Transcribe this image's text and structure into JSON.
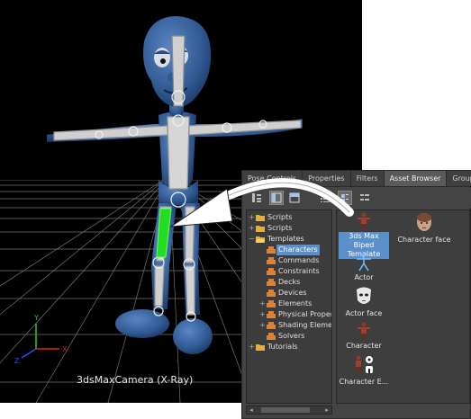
{
  "viewport": {
    "label": "3dsMaxCamera (X-Ray)",
    "axes": {
      "x": "X",
      "y": "Y",
      "z": "Z"
    }
  },
  "panel": {
    "tabs": [
      {
        "label": "Pose Controls",
        "active": false
      },
      {
        "label": "Properties",
        "active": false
      },
      {
        "label": "Filters",
        "active": false
      },
      {
        "label": "Asset Browser",
        "active": true
      },
      {
        "label": "Groups",
        "active": false
      }
    ],
    "tree": [
      {
        "label": "Scripts",
        "depth": 0,
        "expander": "+",
        "icon": "folder-icon"
      },
      {
        "label": "Scripts",
        "depth": 0,
        "expander": "+",
        "icon": "folder-icon"
      },
      {
        "label": "Templates",
        "depth": 0,
        "expander": "−",
        "icon": "folder-icon"
      },
      {
        "label": "Characters",
        "depth": 1,
        "expander": "",
        "icon": "template-icon",
        "selected": true
      },
      {
        "label": "Commands",
        "depth": 1,
        "expander": "",
        "icon": "template-icon"
      },
      {
        "label": "Constraints",
        "depth": 1,
        "expander": "",
        "icon": "template-icon"
      },
      {
        "label": "Decks",
        "depth": 1,
        "expander": "",
        "icon": "template-icon"
      },
      {
        "label": "Devices",
        "depth": 1,
        "expander": "",
        "icon": "template-icon"
      },
      {
        "label": "Elements",
        "depth": 1,
        "expander": "+",
        "icon": "template-icon"
      },
      {
        "label": "Physical Proper",
        "depth": 1,
        "expander": "+",
        "icon": "template-icon"
      },
      {
        "label": "Shading Eleme",
        "depth": 1,
        "expander": "+",
        "icon": "template-icon"
      },
      {
        "label": "Solvers",
        "depth": 1,
        "expander": "",
        "icon": "template-icon"
      },
      {
        "label": "Tutorials",
        "depth": 0,
        "expander": "+",
        "icon": "folder-icon"
      }
    ],
    "assets": [
      {
        "label": "3ds Max Biped Template",
        "line1": "3ds Max Biped",
        "line2": "Template",
        "icon": "biped-template-icon",
        "selected": true
      },
      {
        "label": "Character face",
        "line1": "Character face",
        "line2": "",
        "icon": "character-face-icon"
      },
      {
        "label": "Actor",
        "line1": "Actor",
        "line2": "",
        "icon": "actor-icon"
      },
      {
        "label": "Actor face",
        "line1": "Actor face",
        "line2": "",
        "icon": "actor-face-icon"
      },
      {
        "label": "Character",
        "line1": "Character",
        "line2": "",
        "icon": "character-icon"
      },
      {
        "label": "Character E...",
        "line1": "Character E...",
        "line2": "",
        "icon": "character-extension-icon"
      }
    ]
  },
  "colors": {
    "viewport_bg": "#000000",
    "panel_bg": "#444444",
    "selection": "#5b8fc9",
    "skin": "#3d6aa8",
    "bone_highlight": "#22dd22",
    "axis_x": "#e02020",
    "axis_y": "#20d020",
    "axis_z": "#2050ff"
  }
}
